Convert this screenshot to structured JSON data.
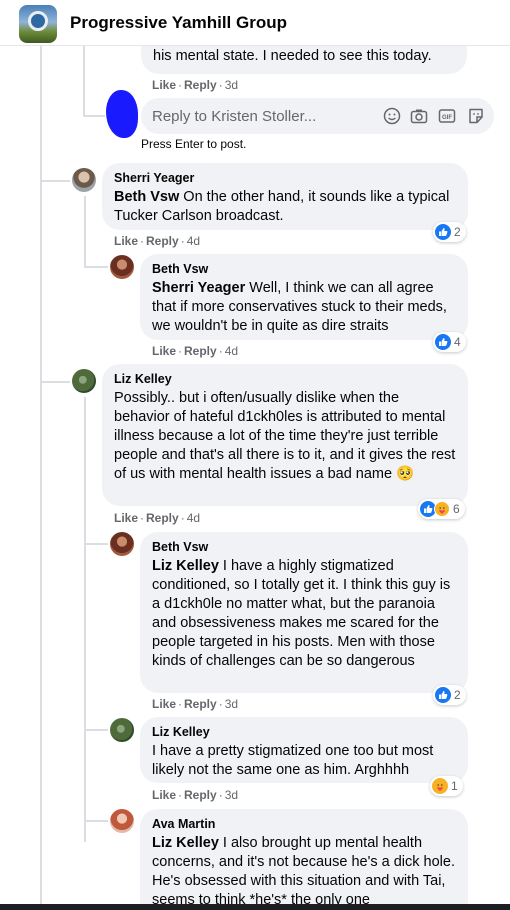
{
  "group": {
    "name": "Progressive Yamhill Group"
  },
  "first_reply_tail": {
    "text": "his mental state. I needed to see this today.",
    "actions": {
      "like": "Like",
      "reply": "Reply",
      "time": "3d"
    }
  },
  "reply_box": {
    "placeholder": "Reply to Kristen Stoller...",
    "hint": "Press Enter to post.",
    "icons": [
      "smiley-icon",
      "camera-icon",
      "gif-icon",
      "sticker-icon"
    ]
  },
  "comments": [
    {
      "author": "Sherri Yeager",
      "mention": "Beth Vsw",
      "text": " On the other hand, it sounds like a typical Tucker Carlson broadcast.",
      "actions": {
        "like": "Like",
        "reply": "Reply",
        "time": "4d"
      },
      "reactions": {
        "types": [
          "like"
        ],
        "count": "2"
      }
    },
    {
      "author": "Beth Vsw",
      "mention": "Sherri Yeager",
      "text": " Well, I think we can all agree that if more conservatives stuck to their meds, we wouldn't be in quite as dire straits",
      "actions": {
        "like": "Like",
        "reply": "Reply",
        "time": "4d"
      },
      "reactions": {
        "types": [
          "like"
        ],
        "count": "4"
      }
    },
    {
      "author": "Liz Kelley",
      "mention": "",
      "text": "Possibly.. but i often/usually dislike when the behavior of hateful d1ckh0les is attributed to mental illness because a lot of the time they're just terrible people and that's all there is to it, and it gives the rest of us with mental health issues a bad name 🥺",
      "actions": {
        "like": "Like",
        "reply": "Reply",
        "time": "4d"
      },
      "reactions": {
        "types": [
          "like",
          "care"
        ],
        "count": "6"
      }
    },
    {
      "author": "Beth Vsw",
      "mention": "Liz Kelley",
      "text": " I have a highly stigmatized conditioned, so I totally get it. I think this guy is a d1ckh0le no matter what, but the paranoia and obsessiveness makes me scared for the people targeted in his posts. Men with those kinds of challenges can be so dangerous",
      "actions": {
        "like": "Like",
        "reply": "Reply",
        "time": "3d"
      },
      "reactions": {
        "types": [
          "like"
        ],
        "count": "2"
      }
    },
    {
      "author": "Liz Kelley",
      "mention": "",
      "text": "I have a pretty stigmatized one too but most likely not the same one as him. Arghhhh",
      "actions": {
        "like": "Like",
        "reply": "Reply",
        "time": "3d"
      },
      "reactions": {
        "types": [
          "care"
        ],
        "count": "1"
      }
    },
    {
      "author": "Ava Martin",
      "mention": "Liz Kelley",
      "text": " I also brought up mental health concerns, and it's not because he's a dick hole. He's obsessed with this situation and with Tai, seems to think *he's* the only one",
      "actions": {
        "like": "",
        "reply": "",
        "time": ""
      },
      "reactions": {
        "types": [],
        "count": ""
      }
    }
  ]
}
